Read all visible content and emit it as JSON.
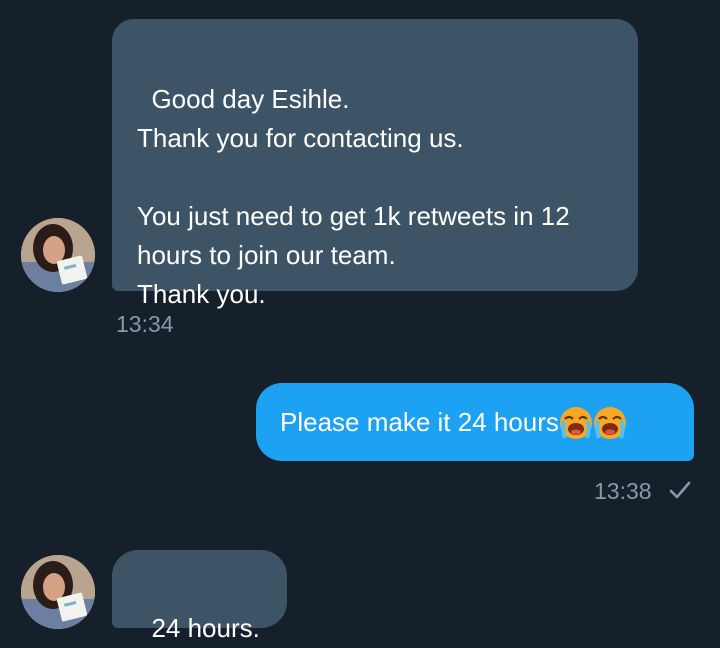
{
  "conversation": {
    "messages": [
      {
        "direction": "incoming",
        "text": "Good day Esihle.\nThank you for contacting us.\n\nYou just need to get 1k retweets in 12 hours to join our team.\nThank you.",
        "time": "13:34"
      },
      {
        "direction": "outgoing",
        "text": "Please make it 24 hours",
        "emojis": [
          "loudly-crying-face",
          "loudly-crying-face"
        ],
        "time": "13:38",
        "status_icon": "check-icon"
      },
      {
        "direction": "incoming",
        "text": "24 hours."
      }
    ]
  },
  "colors": {
    "background": "#15202b",
    "incoming_bubble": "#3d5466",
    "outgoing_bubble": "#1da1f2",
    "timestamp": "#8899a6"
  }
}
